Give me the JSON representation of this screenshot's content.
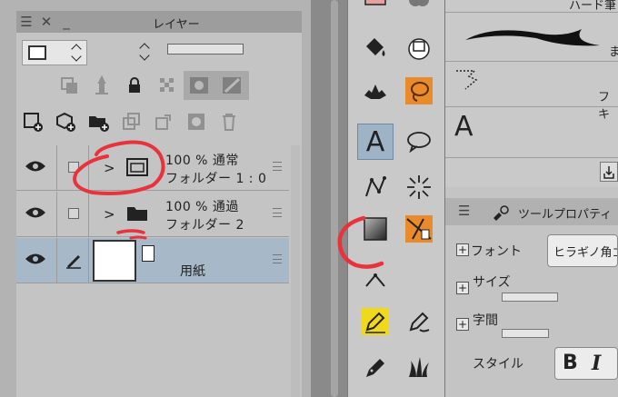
{
  "layer_panel": {
    "title": "レイヤー",
    "layers": [
      {
        "line1": "100 % 通常",
        "line2": "フォルダー 1 : 0",
        "type": "folder-icon-special"
      },
      {
        "line1": "100 % 通過",
        "line2": "フォルダー 2",
        "type": "folder"
      },
      {
        "line1": "",
        "line2": "用紙",
        "type": "paper"
      }
    ]
  },
  "brush_panel": {
    "items": [
      "ハード筆",
      "ま",
      "フキ"
    ]
  },
  "tool_property": {
    "title": "ツールプロパティ",
    "font_label": "フォント",
    "font_value": "ヒラギノ角ゴ",
    "size_label": "サイズ",
    "spacing_label": "字間",
    "style_label": "スタイル",
    "bold": "B",
    "italic": "I",
    "text_tool_glyph": "A",
    "big_a": "A"
  },
  "colors": {
    "annotation_red": "#e8333c",
    "selected_row": "#a7b8c9",
    "tool_selected": "#9fb3c7"
  }
}
